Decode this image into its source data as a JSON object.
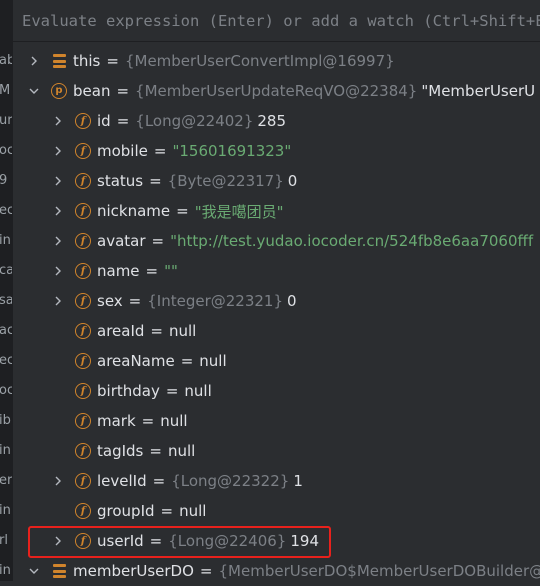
{
  "evaluate": {
    "placeholder": "Evaluate expression (Enter) or add a watch (Ctrl+Shift+Enter)"
  },
  "gutter_fragments": [
    "ab",
    "M",
    "url",
    "oc",
    "9",
    "ec",
    "in",
    "ca",
    "sa",
    "ac",
    "ec",
    "oc",
    "ib",
    "in",
    "er",
    "in",
    "rl",
    "in",
    "oc"
  ],
  "colors": {
    "background": "#2b2d30",
    "field_icon": "#d0842c",
    "type_text": "#7c8086",
    "string_value": "#6aab73",
    "highlight": "#e8211c"
  },
  "variables": {
    "this": {
      "name": "this",
      "type": "{MemberUserConvertImpl@16997}",
      "icon": "stack-icon"
    },
    "bean": {
      "name": "bean",
      "type": "{MemberUserUpdateReqVO@22384}",
      "value": "\"MemberUserU",
      "icon": "parameter-icon"
    },
    "fields": [
      {
        "name": "id",
        "type": "{Long@22402}",
        "value": "285"
      },
      {
        "name": "mobile",
        "str": "\"15601691323\""
      },
      {
        "name": "status",
        "type": "{Byte@22317}",
        "value": "0"
      },
      {
        "name": "nickname",
        "str": "\"我是噶团员\""
      },
      {
        "name": "avatar",
        "str": "\"http://test.yudao.iocoder.cn/524fb8e6aa7060fff"
      },
      {
        "name": "name",
        "str": "\"\""
      },
      {
        "name": "sex",
        "type": "{Integer@22321}",
        "value": "0"
      },
      {
        "name": "areaId",
        "plain": "null"
      },
      {
        "name": "areaName",
        "plain": "null"
      },
      {
        "name": "birthday",
        "plain": "null"
      },
      {
        "name": "mark",
        "plain": "null"
      },
      {
        "name": "tagIds",
        "plain": "null"
      },
      {
        "name": "levelId",
        "type": "{Long@22322}",
        "value": "1"
      },
      {
        "name": "groupId",
        "plain": "null"
      },
      {
        "name": "userId",
        "type": "{Long@22406}",
        "value": "194"
      }
    ],
    "memberUserDO": {
      "name": "memberUserDO",
      "type": "{MemberUserDO$MemberUserDOBuilder@"
    }
  }
}
